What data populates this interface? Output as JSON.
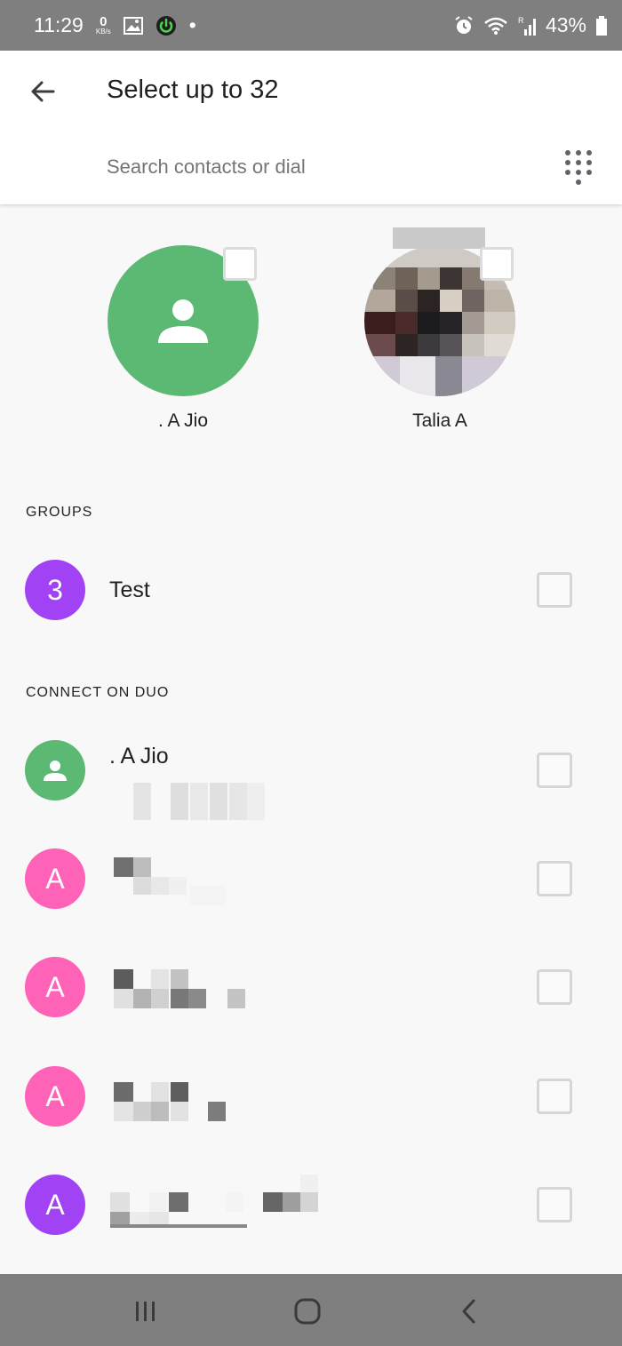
{
  "status_bar": {
    "time": "11:29",
    "net_speed_value": "0",
    "net_speed_unit": "KB/s",
    "battery": "43%",
    "dot": "•",
    "icons": [
      "image-icon",
      "power-icon",
      "alarm-icon",
      "wifi-icon",
      "signal-icon",
      "battery-icon"
    ]
  },
  "header": {
    "title": "Select up to 32",
    "search_placeholder": "Search contacts or dial"
  },
  "selected_contacts": [
    {
      "name": ". A Jio"
    },
    {
      "name": "Talia A"
    }
  ],
  "groups": {
    "label": "GROUPS",
    "items": [
      {
        "avatar_text": "3",
        "name": "Test",
        "color": "#a142f4"
      }
    ]
  },
  "connect": {
    "label": "CONNECT ON DUO",
    "items": [
      {
        "avatar_text": "",
        "name": ". A Jio",
        "color": "#5bb974"
      },
      {
        "avatar_text": "A",
        "name": "",
        "color": "#ff63b8"
      },
      {
        "avatar_text": "A",
        "name": "",
        "color": "#ff63b8"
      },
      {
        "avatar_text": "A",
        "name": "",
        "color": "#ff63b8"
      },
      {
        "avatar_text": "A",
        "name": "",
        "color": "#a142f4"
      }
    ]
  },
  "colors": {
    "status_bar": "#7f7f7f",
    "green_avatar": "#5bb974",
    "pink_avatar": "#ff63b8",
    "purple_avatar": "#a142f4"
  }
}
